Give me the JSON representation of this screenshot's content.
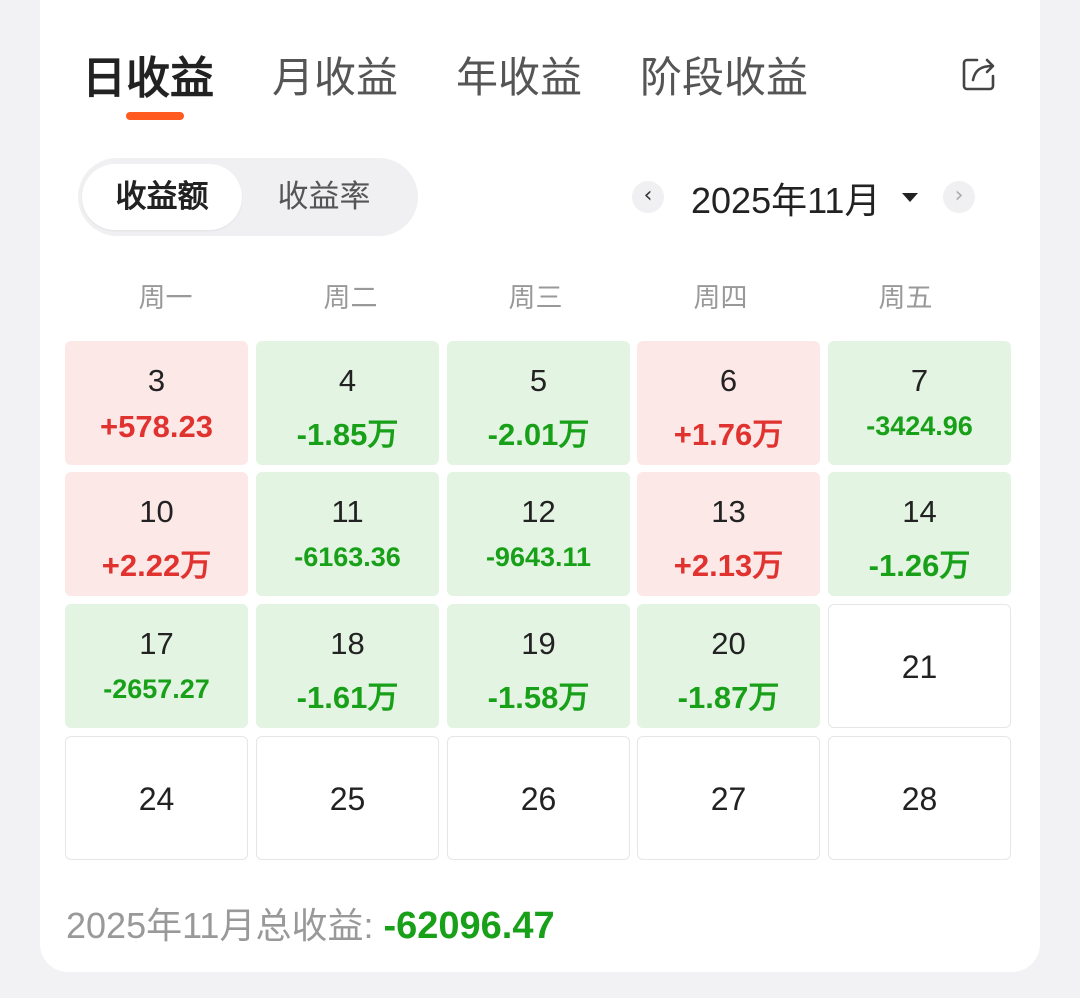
{
  "tabs": [
    {
      "label": "日收益",
      "active": true
    },
    {
      "label": "月收益",
      "active": false
    },
    {
      "label": "年收益",
      "active": false
    },
    {
      "label": "阶段收益",
      "active": false
    }
  ],
  "segment": {
    "amount": "收益额",
    "rate": "收益率",
    "selected": "收益额"
  },
  "month_selector": {
    "prev": "‹",
    "label": "2025年11月",
    "next": "›"
  },
  "weekdays": [
    "周一",
    "周二",
    "周三",
    "周四",
    "周五"
  ],
  "calendar": [
    {
      "day": "3",
      "value": "+578.23",
      "trend": "up"
    },
    {
      "day": "4",
      "value": "-1.85万",
      "trend": "down"
    },
    {
      "day": "5",
      "value": "-2.01万",
      "trend": "down"
    },
    {
      "day": "6",
      "value": "+1.76万",
      "trend": "up"
    },
    {
      "day": "7",
      "value": "-3424.96",
      "trend": "down"
    },
    {
      "day": "10",
      "value": "+2.22万",
      "trend": "up"
    },
    {
      "day": "11",
      "value": "-6163.36",
      "trend": "down"
    },
    {
      "day": "12",
      "value": "-9643.11",
      "trend": "down"
    },
    {
      "day": "13",
      "value": "+2.13万",
      "trend": "up"
    },
    {
      "day": "14",
      "value": "-1.26万",
      "trend": "down"
    },
    {
      "day": "17",
      "value": "-2657.27",
      "trend": "down"
    },
    {
      "day": "18",
      "value": "-1.61万",
      "trend": "down"
    },
    {
      "day": "19",
      "value": "-1.58万",
      "trend": "down"
    },
    {
      "day": "20",
      "value": "-1.87万",
      "trend": "down"
    },
    {
      "day": "21",
      "value": "",
      "trend": "none"
    },
    {
      "day": "24",
      "value": "",
      "trend": "none"
    },
    {
      "day": "25",
      "value": "",
      "trend": "none"
    },
    {
      "day": "26",
      "value": "",
      "trend": "none"
    },
    {
      "day": "27",
      "value": "",
      "trend": "none"
    },
    {
      "day": "28",
      "value": "",
      "trend": "none"
    }
  ],
  "summary": {
    "label": "2025年11月总收益: ",
    "value": "-62096.47"
  },
  "colors": {
    "accent": "#ff5a1f",
    "gain": "#e0322f",
    "loss": "#19a019",
    "gain_bg": "#fde8e8",
    "loss_bg": "#e3f4e3"
  },
  "icons": {
    "share": "share-icon",
    "prev": "chevron-left-icon",
    "next": "chevron-right-icon",
    "caret": "caret-down-icon"
  }
}
